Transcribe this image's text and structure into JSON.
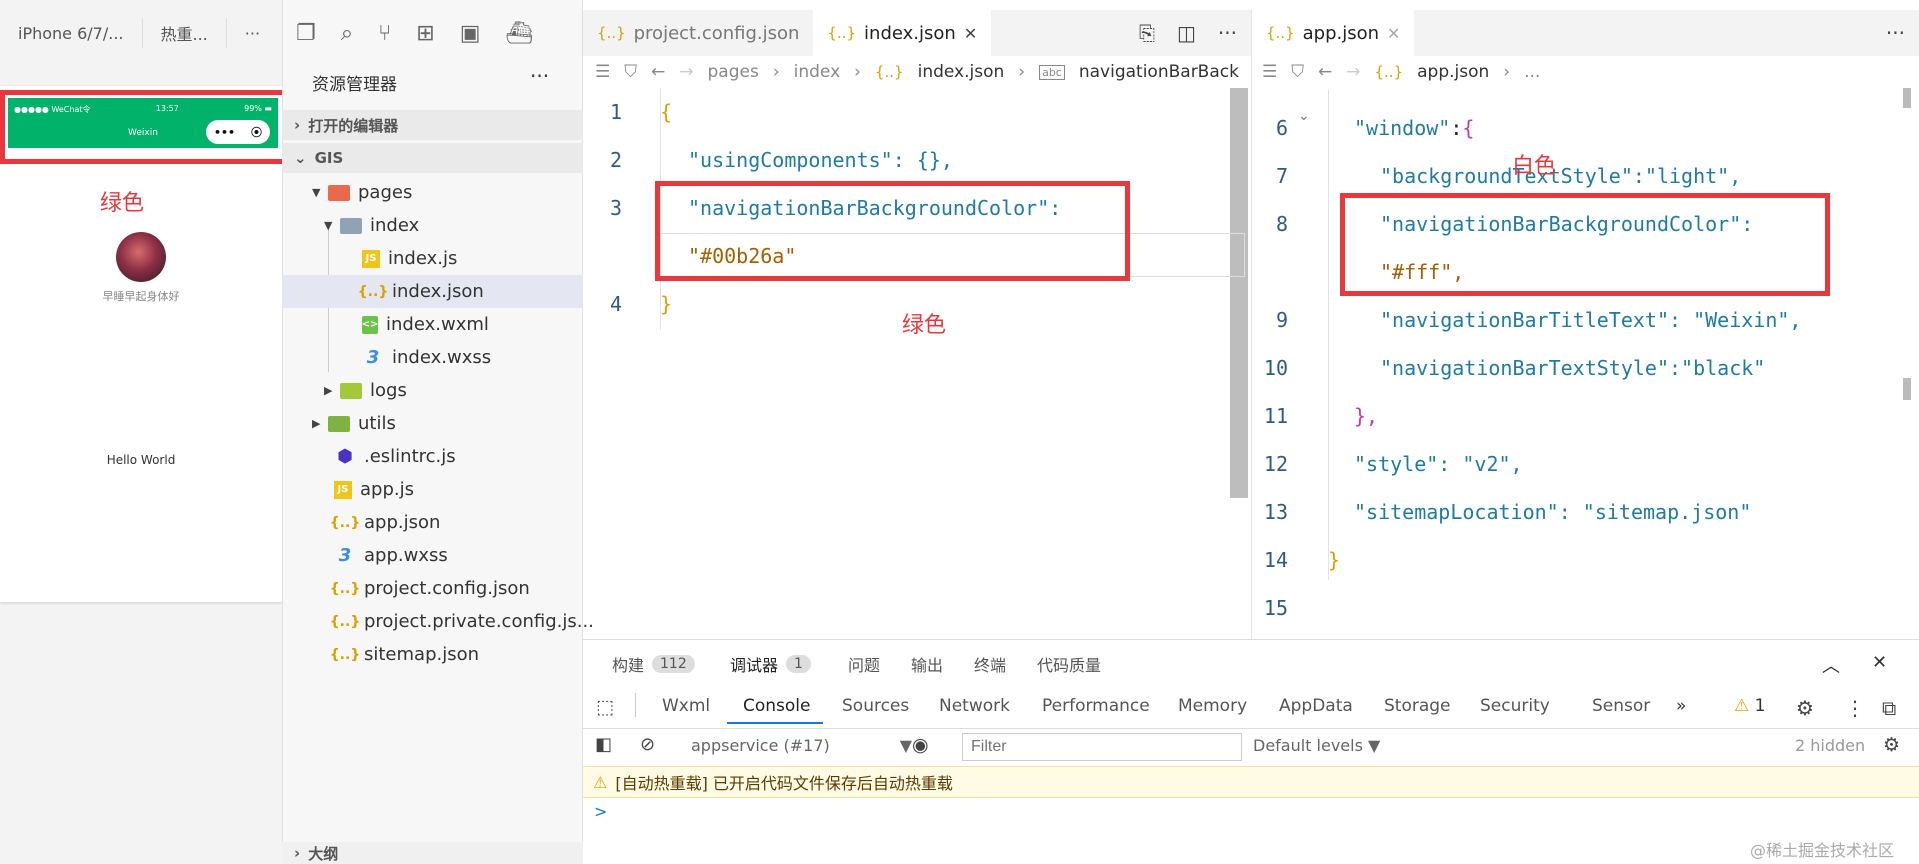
{
  "simulator": {
    "tabs": [
      "iPhone 6/7/...",
      "热重...",
      "···"
    ],
    "navbar": {
      "carrier": "●●●●● WeChat令",
      "time": "13:57",
      "battery": "99%",
      "title": "Weixin",
      "bg_color": "#00b26a"
    },
    "annotation": "绿色",
    "motto": "早睡早起身体好",
    "hello": "Hello World"
  },
  "explorer": {
    "title": "资源管理器",
    "more": "···",
    "open_editors": "打开的编辑器",
    "project": "GIS",
    "outline": "大纲",
    "tree": [
      {
        "label": "pages",
        "icon": "folder-red-icon"
      },
      {
        "label": "index",
        "icon": "folder-icon"
      },
      {
        "label": "index.js",
        "icon": "js-icon"
      },
      {
        "label": "index.json",
        "icon": "json-icon"
      },
      {
        "label": "index.wxml",
        "icon": "wxml-icon"
      },
      {
        "label": "index.wxss",
        "icon": "wxss-icon"
      },
      {
        "label": "logs",
        "icon": "folder-green-icon"
      },
      {
        "label": "utils",
        "icon": "folder-green-icon"
      },
      {
        "label": ".eslintrc.js",
        "icon": "eslint-icon"
      },
      {
        "label": "app.js",
        "icon": "js-icon"
      },
      {
        "label": "app.json",
        "icon": "json-icon"
      },
      {
        "label": "app.wxss",
        "icon": "wxss-icon"
      },
      {
        "label": "project.config.json",
        "icon": "json-icon"
      },
      {
        "label": "project.private.config.js...",
        "icon": "json-icon"
      },
      {
        "label": "sitemap.json",
        "icon": "json-icon"
      }
    ]
  },
  "editor_left": {
    "tabs": [
      "project.config.json",
      "index.json"
    ],
    "breadcrumb": [
      "pages",
      "index",
      "index.json",
      "navigationBarBack"
    ],
    "annotation": "绿色",
    "lines": [
      {
        "n": "1",
        "t": "{"
      },
      {
        "n": "2",
        "t": "\"usingComponents\": {},"
      },
      {
        "n": "3",
        "t": "\"navigationBarBackgroundColor\":"
      },
      {
        "n": "",
        "t": "\"#00b26a\""
      },
      {
        "n": "4",
        "t": "}"
      }
    ]
  },
  "editor_right": {
    "tab": "app.json",
    "breadcrumb": [
      "app.json",
      "..."
    ],
    "annotation": "白色",
    "lines": [
      {
        "n": "6",
        "t": "\"window\":{"
      },
      {
        "n": "7",
        "t": "\"backgroundTextStyle\":\"light\","
      },
      {
        "n": "8",
        "t": "\"navigationBarBackgroundColor\":"
      },
      {
        "n": "",
        "t": "\"#fff\","
      },
      {
        "n": "9",
        "t": "\"navigationBarTitleText\": \"Weixin\","
      },
      {
        "n": "10",
        "t": "\"navigationBarTextStyle\":\"black\""
      },
      {
        "n": "11",
        "t": "},"
      },
      {
        "n": "12",
        "t": "\"style\": \"v2\","
      },
      {
        "n": "13",
        "t": "\"sitemapLocation\": \"sitemap.json\""
      },
      {
        "n": "14",
        "t": "}"
      },
      {
        "n": "15",
        "t": ""
      }
    ]
  },
  "panel": {
    "tabs": [
      {
        "label": "构建",
        "badge": "112"
      },
      {
        "label": "调试器",
        "badge": "1"
      },
      {
        "label": "问题"
      },
      {
        "label": "输出"
      },
      {
        "label": "终端"
      },
      {
        "label": "代码质量"
      }
    ],
    "devtools_tabs": [
      "Wxml",
      "Console",
      "Sources",
      "Network",
      "Performance",
      "Memory",
      "AppData",
      "Storage",
      "Security",
      "Sensor"
    ],
    "overflow": "»",
    "warn_count": "1",
    "context": "appservice (#17)",
    "filter_placeholder": "Filter",
    "levels": "Default levels ▼",
    "hidden": "2 hidden",
    "warning": "[自动热重载] 已开启代码文件保存后自动热重载",
    "prompt": ">"
  },
  "watermark": "@稀土掘金技术社区"
}
